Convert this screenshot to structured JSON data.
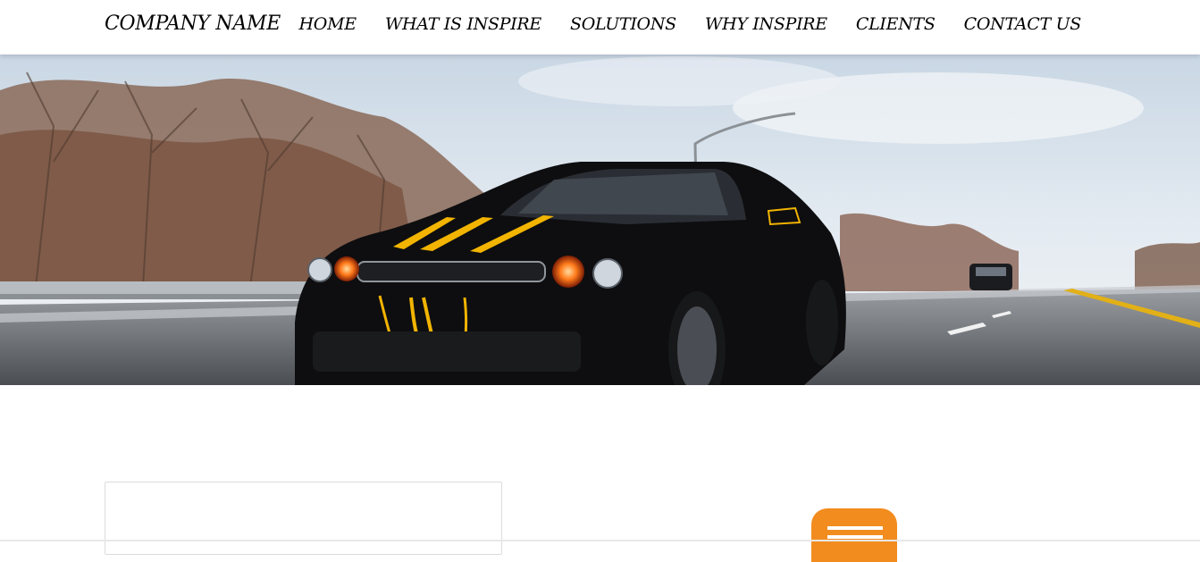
{
  "nav": {
    "brand": "COMPANY NAME",
    "links": [
      "HOME",
      "WHAT IS INSPIRE",
      "SOLUTIONS",
      "WHY INSPIRE",
      "CLIENTS",
      "CONTACT US"
    ]
  },
  "hero": {
    "image": "black-muscle-car-on-highway"
  },
  "colors": {
    "accent": "#f28c1e",
    "car_stripe": "#f2b400",
    "car_body": "#0e0e10",
    "sky": "#dfe8f0"
  },
  "icons": {
    "menu_badge": "hamburger-menu-icon"
  }
}
